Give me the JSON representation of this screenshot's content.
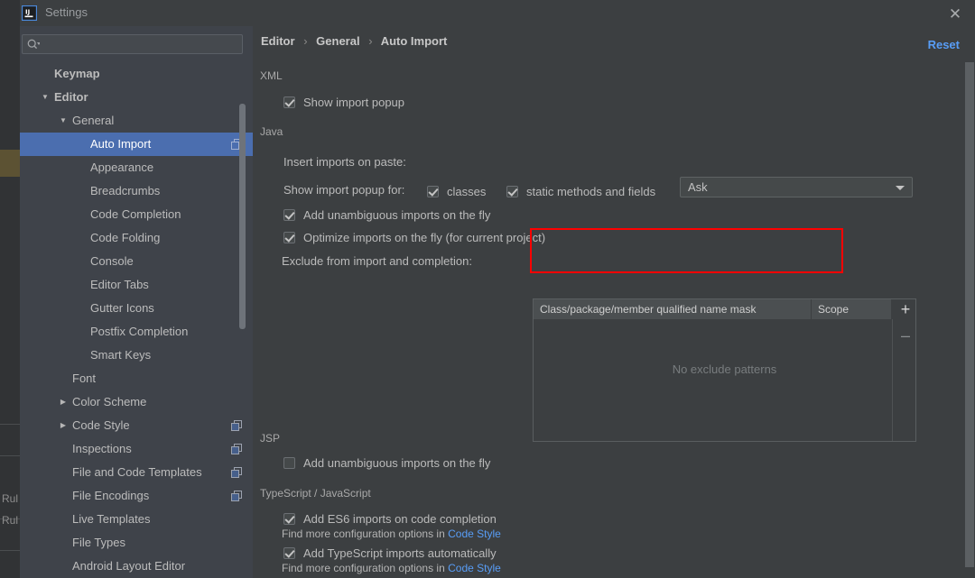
{
  "window": {
    "title": "Settings",
    "app_icon": "intellij-idea-icon",
    "close_label": "✕"
  },
  "colors": {
    "accent_selection": "#4b6eaf",
    "link": "#589df6",
    "highlight_box": "#fe0000",
    "panel_bg": "#3c3f41",
    "sidebar_bg": "#3f434a"
  },
  "search": {
    "value": "",
    "placeholder": "",
    "icon": "search-icon"
  },
  "sidebar": {
    "items": [
      {
        "label": "Keymap",
        "level": 0,
        "arrow": "",
        "bold": true,
        "selected": false,
        "copy_icon": false
      },
      {
        "label": "Editor",
        "level": 0,
        "arrow": "▼",
        "bold": true,
        "selected": false,
        "copy_icon": false
      },
      {
        "label": "General",
        "level": 1,
        "arrow": "▼",
        "bold": false,
        "selected": false,
        "copy_icon": false
      },
      {
        "label": "Auto Import",
        "level": 2,
        "arrow": "",
        "bold": false,
        "selected": true,
        "copy_icon": true
      },
      {
        "label": "Appearance",
        "level": 2,
        "arrow": "",
        "bold": false,
        "selected": false,
        "copy_icon": false
      },
      {
        "label": "Breadcrumbs",
        "level": 2,
        "arrow": "",
        "bold": false,
        "selected": false,
        "copy_icon": false
      },
      {
        "label": "Code Completion",
        "level": 2,
        "arrow": "",
        "bold": false,
        "selected": false,
        "copy_icon": false
      },
      {
        "label": "Code Folding",
        "level": 2,
        "arrow": "",
        "bold": false,
        "selected": false,
        "copy_icon": false
      },
      {
        "label": "Console",
        "level": 2,
        "arrow": "",
        "bold": false,
        "selected": false,
        "copy_icon": false
      },
      {
        "label": "Editor Tabs",
        "level": 2,
        "arrow": "",
        "bold": false,
        "selected": false,
        "copy_icon": false
      },
      {
        "label": "Gutter Icons",
        "level": 2,
        "arrow": "",
        "bold": false,
        "selected": false,
        "copy_icon": false
      },
      {
        "label": "Postfix Completion",
        "level": 2,
        "arrow": "",
        "bold": false,
        "selected": false,
        "copy_icon": false
      },
      {
        "label": "Smart Keys",
        "level": 2,
        "arrow": "",
        "bold": false,
        "selected": false,
        "copy_icon": false
      },
      {
        "label": "Font",
        "level": 1,
        "arrow": "",
        "bold": false,
        "selected": false,
        "copy_icon": false
      },
      {
        "label": "Color Scheme",
        "level": 1,
        "arrow": "▶",
        "bold": false,
        "selected": false,
        "copy_icon": false
      },
      {
        "label": "Code Style",
        "level": 1,
        "arrow": "▶",
        "bold": false,
        "selected": false,
        "copy_icon": true
      },
      {
        "label": "Inspections",
        "level": 1,
        "arrow": "",
        "bold": false,
        "selected": false,
        "copy_icon": true
      },
      {
        "label": "File and Code Templates",
        "level": 1,
        "arrow": "",
        "bold": false,
        "selected": false,
        "copy_icon": true
      },
      {
        "label": "File Encodings",
        "level": 1,
        "arrow": "",
        "bold": false,
        "selected": false,
        "copy_icon": true
      },
      {
        "label": "Live Templates",
        "level": 1,
        "arrow": "",
        "bold": false,
        "selected": false,
        "copy_icon": false
      },
      {
        "label": "File Types",
        "level": 1,
        "arrow": "",
        "bold": false,
        "selected": false,
        "copy_icon": false
      },
      {
        "label": "Android Layout Editor",
        "level": 1,
        "arrow": "",
        "bold": false,
        "selected": false,
        "copy_icon": false
      }
    ]
  },
  "main": {
    "breadcrumb": {
      "parts": [
        "Editor",
        "General",
        "Auto Import"
      ],
      "separator": "›"
    },
    "reset_label": "Reset",
    "groups": {
      "xml": {
        "title": "XML",
        "show_import_popup": {
          "label": "Show import popup",
          "checked": true
        }
      },
      "java": {
        "title": "Java",
        "insert_imports_label": "Insert imports on paste:",
        "insert_imports_value": "Ask",
        "show_import_popup_for_label": "Show import popup for:",
        "classes": {
          "label": "classes",
          "checked": true
        },
        "static_methods": {
          "label": "static methods and fields",
          "checked": true
        },
        "add_unambiguous": {
          "label": "Add unambiguous imports on the fly",
          "checked": true
        },
        "optimize_imports": {
          "label": "Optimize imports on the fly (for current project)",
          "checked": true
        },
        "exclude_label": "Exclude from import and completion:",
        "table": {
          "columns": [
            "Class/package/member qualified name mask",
            "Scope"
          ],
          "rows": [],
          "empty_text": "No exclude patterns",
          "add_button": "+",
          "remove_button": "–"
        }
      },
      "jsp": {
        "title": "JSP",
        "add_unambiguous": {
          "label": "Add unambiguous imports on the fly",
          "checked": false
        }
      },
      "ts_js": {
        "title": "TypeScript / JavaScript",
        "add_es6": {
          "label": "Add ES6 imports on code completion",
          "checked": true
        },
        "hint1_prefix": "Find more configuration options in ",
        "hint1_link": "Code Style",
        "add_ts": {
          "label": "Add TypeScript imports automatically",
          "checked": true
        },
        "hint2_prefix": "Find more configuration options in ",
        "hint2_link": "Code Style"
      }
    }
  },
  "background": {
    "clipped_labels": [
      "Rul",
      "Rul"
    ]
  }
}
